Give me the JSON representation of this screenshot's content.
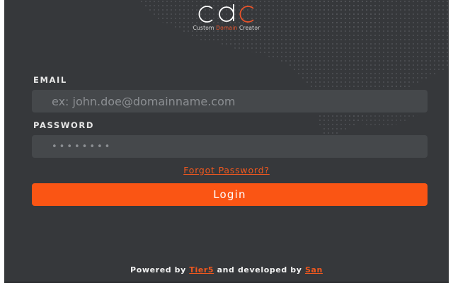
{
  "app": {
    "logo_text": "cdc",
    "tagline_prefix": "Custom ",
    "tagline_accent": "Domain",
    "tagline_suffix": " Creator"
  },
  "form": {
    "email_label": "EMAIL",
    "email_placeholder": "ex: john.doe@domainname.com",
    "password_label": "PASSWORD",
    "password_placeholder": "••••••••",
    "forgot_label": "Forgot Password?",
    "login_label": "Login"
  },
  "footer": {
    "powered_by": "Powered by ",
    "company": "Tier5",
    "developed_by": " and developed by ",
    "developer": "San"
  },
  "colors": {
    "background": "#36383b",
    "input_bg": "#45484b",
    "accent": "#fa5514"
  }
}
